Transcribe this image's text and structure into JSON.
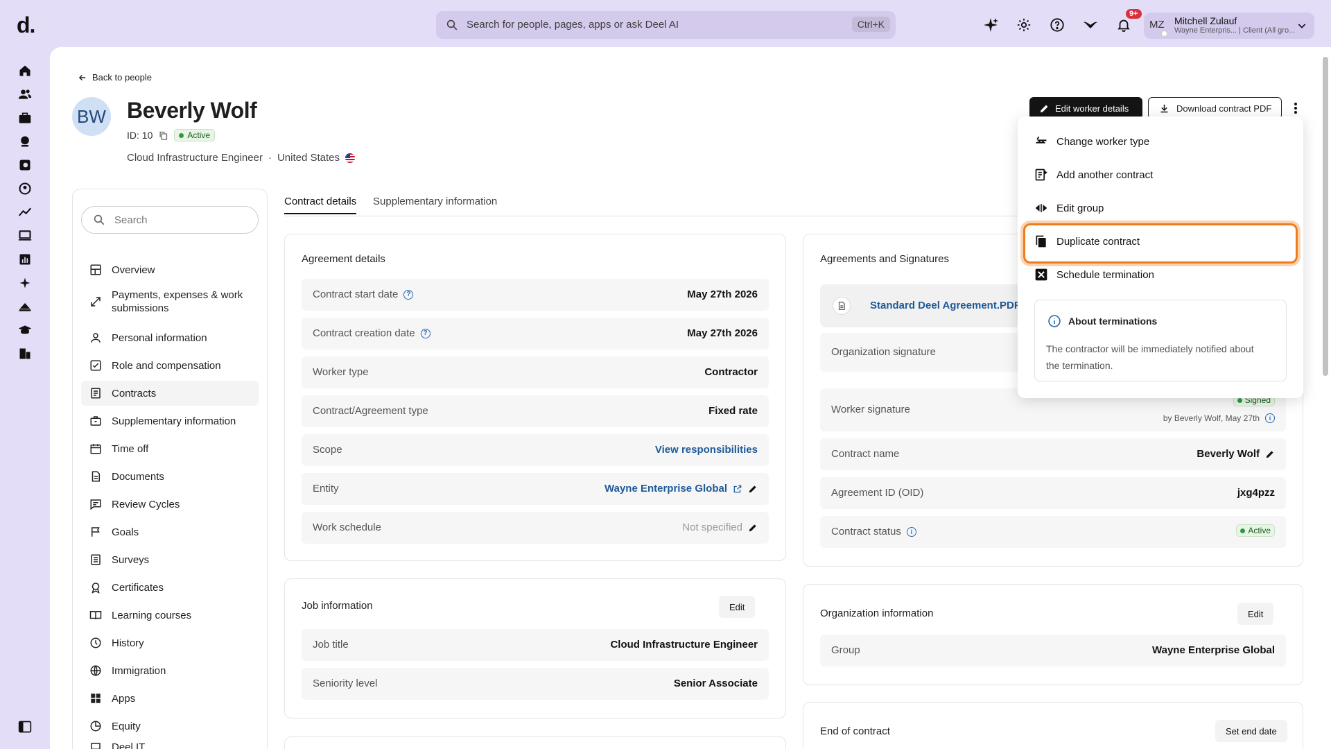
{
  "topbar": {
    "logo": "d.",
    "search_placeholder": "Search for people, pages, apps or ask Deel AI",
    "search_shortcut": "Ctrl+K",
    "notification_badge": "9+",
    "user_initials": "MZ",
    "user_name": "Mitchell Zulauf",
    "user_sub": "Wayne Enterpris... | Client (All gro..."
  },
  "header": {
    "back_label": "Back to people",
    "avatar_initials": "BW",
    "name": "Beverly Wolf",
    "id_label": "ID: 10",
    "status": "Active",
    "role": "Cloud Infrastructure Engineer",
    "separator": "·",
    "country": "United States",
    "edit_button": "Edit worker details",
    "download_button": "Download contract PDF"
  },
  "sidebar": {
    "search_placeholder": "Search",
    "items": [
      {
        "label": "Overview",
        "icon": "layout-icon"
      },
      {
        "label": "Payments, expenses & work submissions",
        "icon": "arrows-icon"
      },
      {
        "label": "Personal information",
        "icon": "person-icon"
      },
      {
        "label": "Role and compensation",
        "icon": "checkbox-icon"
      },
      {
        "label": "Contracts",
        "icon": "contract-icon"
      },
      {
        "label": "Supplementary information",
        "icon": "briefcase-icon"
      },
      {
        "label": "Time off",
        "icon": "calendar-icon"
      },
      {
        "label": "Documents",
        "icon": "document-icon"
      },
      {
        "label": "Review Cycles",
        "icon": "chat-icon"
      },
      {
        "label": "Goals",
        "icon": "flag-icon"
      },
      {
        "label": "Surveys",
        "icon": "list-icon"
      },
      {
        "label": "Certificates",
        "icon": "certificate-icon"
      },
      {
        "label": "Learning courses",
        "icon": "book-icon"
      },
      {
        "label": "History",
        "icon": "history-icon"
      },
      {
        "label": "Immigration",
        "icon": "globe-icon"
      },
      {
        "label": "Apps",
        "icon": "apps-icon"
      },
      {
        "label": "Equity",
        "icon": "pie-icon"
      },
      {
        "label": "Deel IT",
        "icon": "laptop-icon"
      }
    ]
  },
  "tabs": [
    "Contract details",
    "Supplementary information"
  ],
  "agreement": {
    "title": "Agreement details",
    "rows": [
      {
        "label": "Contract start date",
        "value": "May 27th 2026"
      },
      {
        "label": "Contract creation date",
        "value": "May 27th 2026"
      },
      {
        "label": "Worker type",
        "value": "Contractor"
      },
      {
        "label": "Contract/Agreement type",
        "value": "Fixed rate"
      },
      {
        "label": "Scope",
        "value": "View responsibilities"
      },
      {
        "label": "Entity",
        "value": "Wayne Enterprise Global"
      },
      {
        "label": "Work schedule",
        "value": "Not specified"
      }
    ]
  },
  "job": {
    "title": "Job information",
    "edit": "Edit",
    "rows": [
      {
        "label": "Job title",
        "value": "Cloud Infrastructure Engineer"
      },
      {
        "label": "Seniority level",
        "value": "Senior Associate"
      }
    ]
  },
  "signatures": {
    "title": "Agreements and Signatures",
    "pdf_name": "Standard Deel Agreement.PDF",
    "org_signature": "Organization signature",
    "worker_signature": "Worker signature",
    "signed_badge": "Signed",
    "signed_by": "by Beverly Wolf, May 27th",
    "contract_name_label": "Contract name",
    "contract_name_value": "Beverly Wolf",
    "agreement_id_label": "Agreement ID (OID)",
    "agreement_id_value": "jxg4pzz",
    "status_label": "Contract status",
    "status_value": "Active"
  },
  "organization": {
    "title": "Organization information",
    "edit": "Edit",
    "group_label": "Group",
    "group_value": "Wayne Enterprise Global"
  },
  "end_of_contract": {
    "title": "End of contract",
    "button": "Set end date"
  },
  "dropdown": {
    "items": [
      "Change worker type",
      "Add another contract",
      "Edit group",
      "Duplicate contract",
      "Schedule termination"
    ],
    "about_title": "About terminations",
    "about_body": "The contractor will be immediately notified about the termination."
  }
}
